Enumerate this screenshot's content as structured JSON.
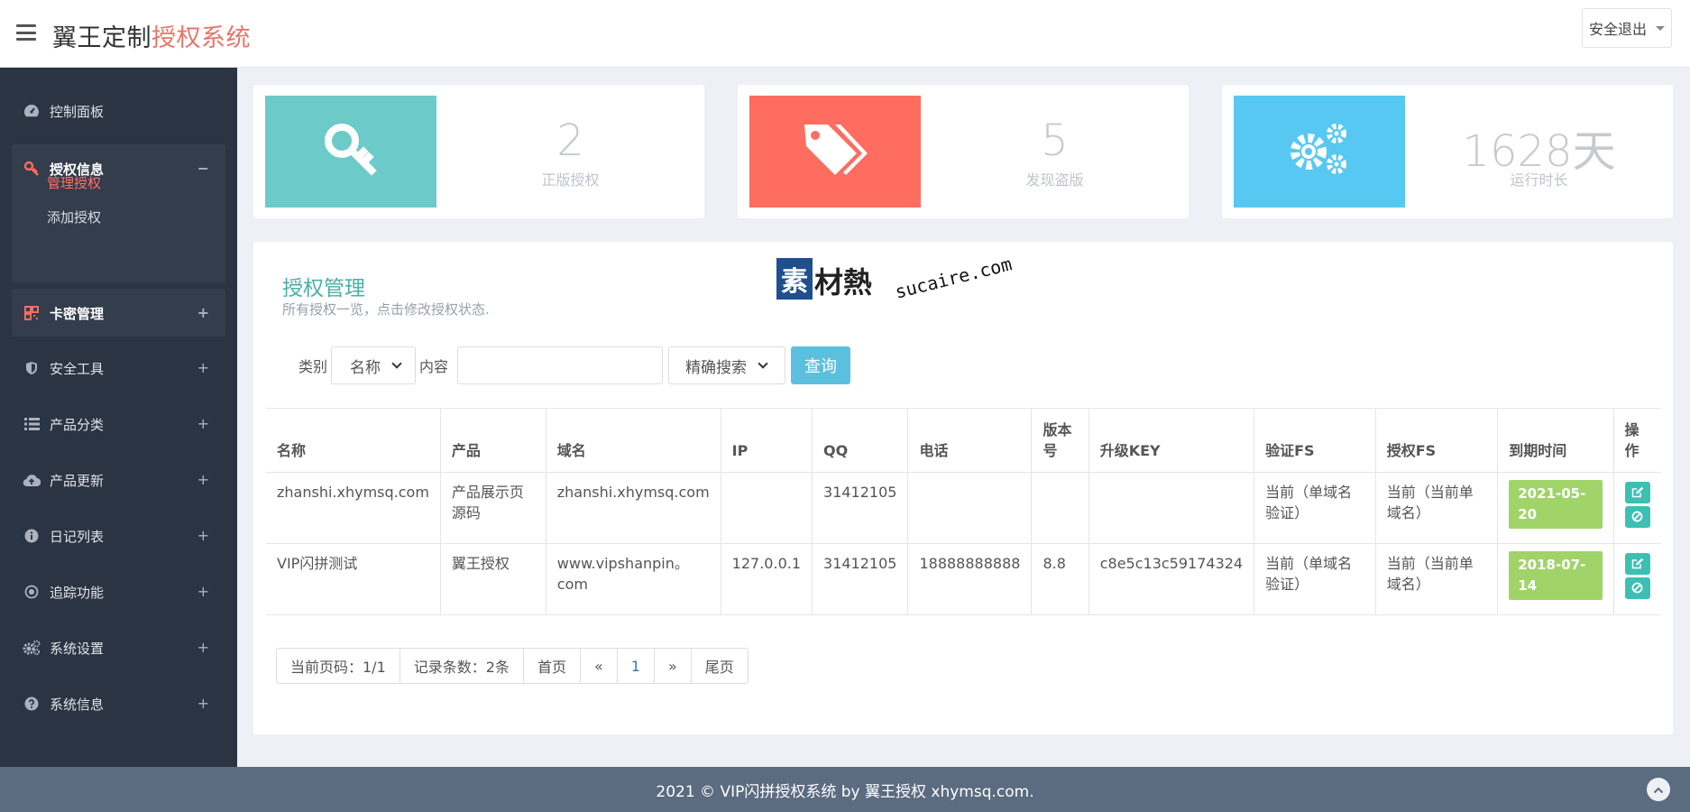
{
  "header": {
    "brand_main": "翼王定制",
    "brand_accent": "授权系统",
    "logout_label": "安全退出"
  },
  "sidebar": {
    "items": [
      {
        "label": "控制面板",
        "icon": "dashboard-icon"
      },
      {
        "label": "授权信息",
        "icon": "key-icon",
        "toggle": "−"
      },
      {
        "label": "卡密管理",
        "icon": "qrcode-icon",
        "toggle": "+"
      },
      {
        "label": "安全工具",
        "icon": "shield-icon",
        "toggle": "+"
      },
      {
        "label": "产品分类",
        "icon": "list-icon",
        "toggle": "+"
      },
      {
        "label": "产品更新",
        "icon": "cloud-upload-icon",
        "toggle": "+"
      },
      {
        "label": "日记列表",
        "icon": "info-icon",
        "toggle": "+"
      },
      {
        "label": "追踪功能",
        "icon": "target-icon",
        "toggle": "+"
      },
      {
        "label": "系统设置",
        "icon": "cogs-icon",
        "toggle": "+"
      },
      {
        "label": "系统信息",
        "icon": "question-icon",
        "toggle": "+"
      }
    ],
    "sub_items": [
      "管理授权",
      "添加授权"
    ]
  },
  "stats": [
    {
      "value": "2",
      "label": "正版授权",
      "color": "#6ccac9",
      "icon": "key-icon"
    },
    {
      "value": "5",
      "label": "发现盗版",
      "color": "#ff6c60",
      "icon": "tags-icon"
    },
    {
      "value": "1628天",
      "label": "运行时长",
      "color": "#57c8f2",
      "icon": "cogs-icon"
    }
  ],
  "panel": {
    "title": "授权管理",
    "subtitle": "所有授权一览，点击修改授权状态.",
    "watermark_box": "素",
    "watermark_text": "材熱",
    "watermark_url": "sucaire.com"
  },
  "filter": {
    "category_label": "类别",
    "category_value": "名称",
    "content_label": "内容",
    "content_value": "",
    "mode_value": "精确搜索",
    "query_label": "查询"
  },
  "table": {
    "headers": [
      "名称",
      "产品",
      "域名",
      "IP",
      "QQ",
      "电话",
      "版本号",
      "升级KEY",
      "验证FS",
      "授权FS",
      "到期时间",
      "操作"
    ],
    "rows": [
      [
        "zhanshi.xhymsq.com",
        "产品展示页源码",
        "zhanshi.xhymsq.com",
        "",
        "31412105",
        "",
        "",
        "",
        "当前（单域名验证）",
        "当前（当前单域名）",
        "2021-05-20"
      ],
      [
        "VIP闪拼测试",
        "翼王授权",
        "www.vipshanpin。com",
        "127.0.0.1",
        "31412105",
        "18888888888",
        "8.8",
        "c8e5c13c59174324",
        "当前（单域名验证）",
        "当前（当前单域名）",
        "2018-07-14"
      ]
    ]
  },
  "pager": {
    "current": "当前页码：1/1",
    "count": "记录条数：2条",
    "first": "首页",
    "prev": "«",
    "page": "1",
    "next": "»",
    "last": "尾页"
  },
  "footer": {
    "text": "2021 © VIP闪拼授权系统 by 翼王授权 xhymsq.com."
  }
}
